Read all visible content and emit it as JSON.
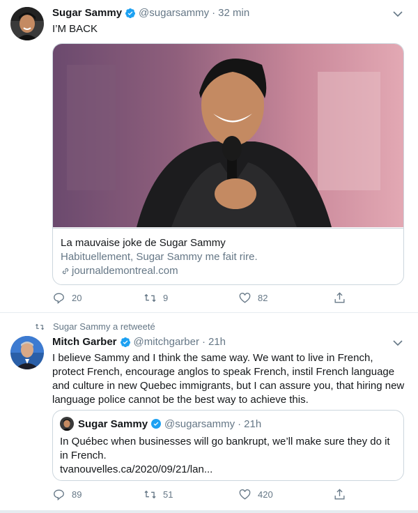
{
  "tweets": [
    {
      "author_name": "Sugar Sammy",
      "handle": "@sugarsammy",
      "dot": "·",
      "time": "32 min",
      "text": "I’M BACK",
      "card": {
        "title": "La mauvaise joke de Sugar Sammy",
        "description": "Habituellement, Sugar Sammy me fait rire.",
        "domain": "journaldemontreal.com"
      },
      "actions": {
        "replies": "20",
        "retweets": "9",
        "likes": "82"
      }
    },
    {
      "retweeted_by": "Sugar Sammy a retweeté",
      "author_name": "Mitch Garber",
      "handle": "@mitchgarber",
      "dot": "·",
      "time": "21h",
      "text": "I believe Sammy and I think the same way. We want to live in French, protect French, encourage anglos to speak French, instil French language and culture in new Quebec immigrants, but I can assure you, that hiring new language police cannot be the best way to achieve this.",
      "quote": {
        "author_name": "Sugar Sammy",
        "handle": "@sugarsammy",
        "dot": "·",
        "time": "21h",
        "text": "In Québec when businesses will go bankrupt, we’ll make sure they do it in French.",
        "link": "tvanouvelles.ca/2020/09/21/lan..."
      },
      "actions": {
        "replies": "89",
        "retweets": "51",
        "likes": "420"
      }
    }
  ],
  "colors": {
    "text": "#14171a",
    "secondary": "#657786",
    "verified": "#1da1f2",
    "border": "#ccd6dd"
  },
  "icons": [
    "verified-badge-icon",
    "chevron-down-icon",
    "reply-icon",
    "retweet-icon",
    "like-icon",
    "share-icon",
    "link-icon"
  ]
}
